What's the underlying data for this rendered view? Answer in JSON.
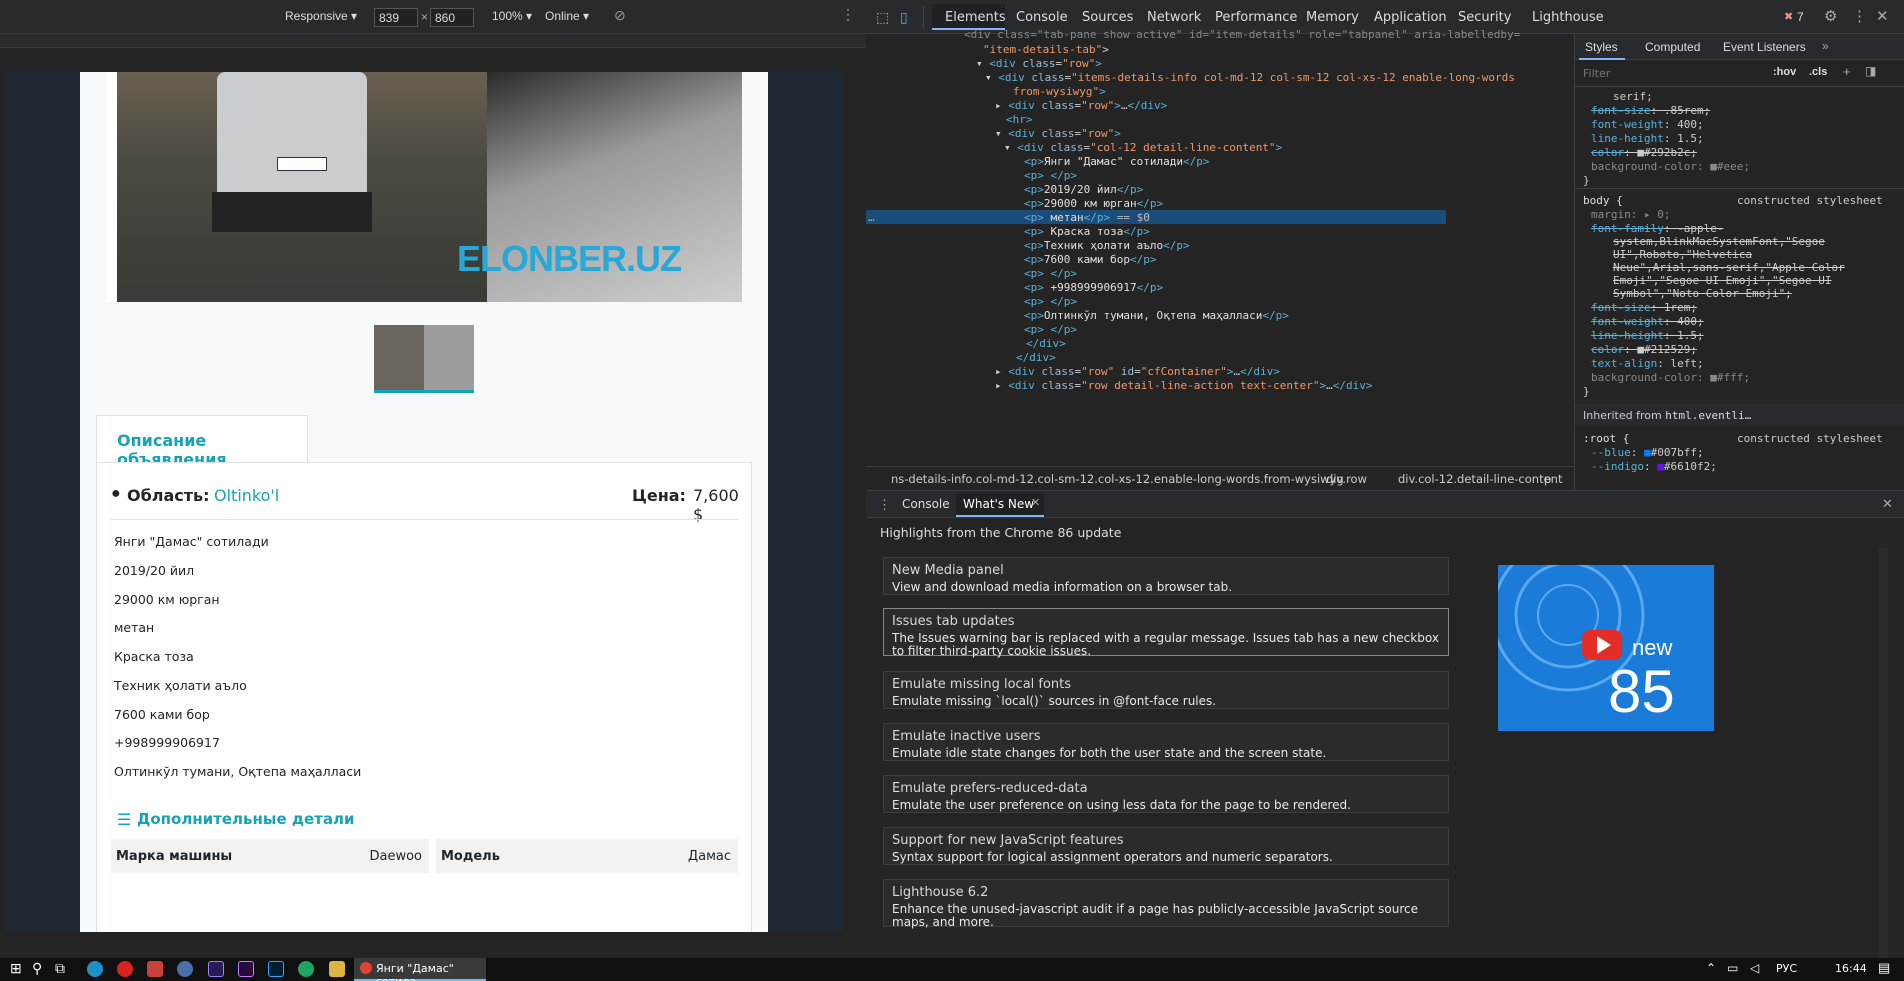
{
  "device_toolbar": {
    "mode": "Responsive",
    "width": "839",
    "height": "860",
    "zoom": "100%",
    "network": "Online"
  },
  "page": {
    "watermark": "ELONBER.UZ",
    "tab_label": "Описание объявления",
    "region_label": "Область:",
    "region_value": "Oltinko'l",
    "price_label": "Цена:",
    "price_value": "7,600 $",
    "lines": [
      "Янги \"Дамас\" сотилади",
      "2019/20 йил",
      "29000 км юрган",
      " метан",
      " Краска тоза",
      "Техник ҳолати аъло",
      "7600 ками бор",
      " +998999906917",
      "Олтинкўл тумани, Оқтепа маҳалласи"
    ],
    "extra_details_title": "Дополнительные детали",
    "details": [
      {
        "label": "Марка машины",
        "value": "Daewoo"
      },
      {
        "label": "Модель",
        "value": "Дамас"
      }
    ]
  },
  "devtools": {
    "tabs": [
      "Elements",
      "Console",
      "Sources",
      "Network",
      "Performance",
      "Memory",
      "Application",
      "Security",
      "Lighthouse"
    ],
    "error_count": "7",
    "style_tabs": [
      "Styles",
      "Computed",
      "Event Listeners"
    ],
    "filter_placeholder": "Filter",
    "hov": ":hov",
    "cls": ".cls",
    "crumbs": [
      "ns-details-info.col-md-12.col-sm-12.col-xs-12.enable-long-words.from-wysiwyg",
      "div.row",
      "div.col-12.detail-line-content",
      "p"
    ],
    "drawer_tabs": [
      "Console",
      "What's New"
    ],
    "whats_new_header": "Highlights from the Chrome 86 update",
    "whats_new": [
      {
        "title": "New Media panel",
        "desc": "View and download media information on a browser tab."
      },
      {
        "title": "Issues tab updates",
        "desc": "The Issues warning bar is replaced with a regular message. Issues tab has a new checkbox to filter third-party cookie issues."
      },
      {
        "title": "Emulate missing local fonts",
        "desc": "Emulate missing `local()` sources in @font-face rules."
      },
      {
        "title": "Emulate inactive users",
        "desc": "Emulate idle state changes for both the user state and the screen state."
      },
      {
        "title": "Emulate prefers-reduced-data",
        "desc": "Emulate the user preference on using less data for the page to be rendered."
      },
      {
        "title": "Support for new JavaScript features",
        "desc": "Syntax support for logical assignment operators and numeric separators."
      },
      {
        "title": "Lighthouse 6.2",
        "desc": "Enhance the unused-javascript audit if a page has publicly-accessible JavaScript source maps, and more."
      }
    ],
    "promo_word": "new",
    "promo_number": "85"
  },
  "taskbar": {
    "active_window": "Янги \"Дамас\" сотила...",
    "lang": "РУС",
    "time": "16:44"
  },
  "colors": {
    "accent": "#17a2b8",
    "devtools_selected": "#1a4c7a"
  }
}
